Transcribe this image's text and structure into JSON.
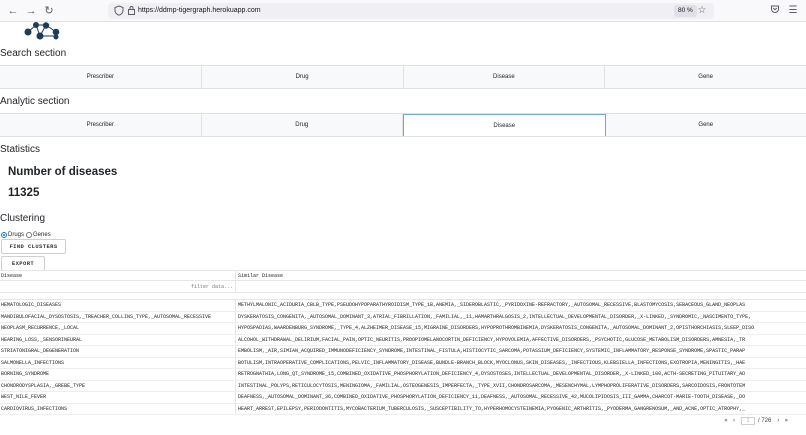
{
  "browser": {
    "url": "https://ddmp-tigergraph.herokuapp.com",
    "zoom": "80 %"
  },
  "search_section": {
    "title": "Search section",
    "tabs": [
      "Prescriber",
      "Drug",
      "Disease",
      "Gene"
    ]
  },
  "analytic_section": {
    "title": "Analytic section",
    "tabs": [
      "Prescriber",
      "Drug",
      "Disease",
      "Gene"
    ],
    "active_tab": "Disease"
  },
  "statistics": {
    "title": "Statistics",
    "metric_label": "Number of diseases",
    "metric_value": "11325"
  },
  "clustering": {
    "title": "Clustering",
    "options": [
      "Drugs",
      "Genes"
    ],
    "selected": "Drugs",
    "find_button": "FIND CLUSTERS",
    "export_button": "EXPORT"
  },
  "table": {
    "columns": [
      "Disease",
      "Similar Disease"
    ],
    "filter_placeholder": "filter data...",
    "rows": [
      [
        "HEMATOLOGIC_DISEASES",
        "METHYLMALONIC_ACIDURIA_CBLB_TYPE,PSEUDOHYPOPARATHYROIDISM_TYPE_1B,ANEMIA,_SIDEROBLASTIC,_PYRIDOXINE-REFRACTORY,_AUTOSOMAL_RECESSIVE,BLASTOMYCOSIS,SEBACEOUS_GLAND_NEOPLAS"
      ],
      [
        "MANDIBULOFACIAL_DYSOSTOSIS,_TREACHER_COLLINS_TYPE,_AUTOSOMAL_RECESSIVE",
        "DYSKERATOSIS_CONGENITA,_AUTOSOMAL_DOMINANT_3,ATRIAL_FIBRILLATION,_FAMILIAL,_11,HAMARTHRALGOSIS_2,INTELLECTUAL_DEVELOPMENTAL_DISORDER,_X-LINKED,_SYNDROMIC,_NASCIMENTO_TYPE,"
      ],
      [
        "NEOPLASM_RECURRENCE,_LOCAL",
        "HYPOSPADIAS,WAARDENBURG_SYNDROME,_TYPE_4,ALZHEIMER_DISEASE_15,MIGRAINE_DISORDERS,HYPOPROTHROMBINEMIA,DYSKERATOSIS_CONGENITA,_AUTOSOMAL_DOMINANT_2,OPISTHORCHIASIS,SLEEP_DISO"
      ],
      [
        "HEARING_LOSS,_SENSORINEURAL",
        "ALCOHOL_WITHDRAWAL_DELIRIUM,FACIAL_PAIN,OPTIC_NEURITIS,PROOPIOMELANOCORTIN_DEFICIENCY,HYPOVOLEMIA,AFFECTIVE_DISORDERS,_PSYCHOTIC,GLUCOSE_METABOLISM_DISORDERS,AMNESIA,_TR"
      ],
      [
        "STRIATONIGRAL_DEGENERATION",
        "EMBOLISM,_AIR,SIMIAN_ACQUIRED_IMMUNODEFICIENCY_SYNDROME,INTESTINAL_FISTULA,HISTIOCYTIC_SARCOMA,POTASSIUM_DEFICIENCY,SYSTEMIC_INFLAMMATORY_RESPONSE_SYNDROME,SPASTIC_PARAP"
      ],
      [
        "SALMONELLA_INFECTIONS",
        "BOTULISM,INTRAOPERATIVE_COMPLICATIONS,PELVIC_INFLAMMATORY_DISEASE,BUNDLE-BRANCH_BLOCK,MYOCLONUS,SKIN_DISEASES,_INFECTIOUS,KLEBSIELLA_INFECTIONS,EXOTROPIA,MENINGITIS,_HAE"
      ],
      [
        "BORNING_SYNDROME",
        "RETROGNATHIA,LONG_QT_SYNDROME_15,COMBINED_OXIDATIVE_PHOSPHORYLATION_DEFICIENCY_4,DYSOSTOSES,INTELLECTUAL_DEVELOPMENTAL_DISORDER,_X-LINKED_100,ACTH-SECRETING_PITUITARY_AD"
      ],
      [
        "CHONDRODYSPLASIA,_GREBE_TYPE",
        "INTESTINAL_POLYPS,RETICULOCYTOSIS,MENINGIOMA,_FAMILIAL,OSTEOGENESIS_IMPERFECTA,_TYPE_XVII,CHONDROSARCOMA,_MESENCHYMAL,LYMPHOPROLIFERATIVE_DISORDERS,SARCOIDOSIS,FRONTOTEM"
      ],
      [
        "WEST_NILE_FEVER",
        "DEAFNESS,_AUTOSOMAL_DOMINANT_36,COMBINED_OXIDATIVE_PHOSPHORYLATION_DEFICIENCY_11,DEAFNESS,_AUTOSOMAL_RECESSIVE_42,MUCOLIPIDOSIS_III_GAMMA,CHARCOT-MARIE-TOOTH_DISEASE,_DO"
      ],
      [
        "CARDIOVIRUS_INFECTIONS",
        "HEART_ARREST,EPILEPSY,PERIODONTITIS,MYCOBACTERIUM_TUBERCULOSIS,_SUSCEPTIBILITY_TO,HYPERHOMOCYSTEINEMIA,PYOGENIC_ARTHRITIS,_PYODERMA_GANGRENOSUM,_AND_ACNE,OPTIC_ATROPHY,_"
      ]
    ]
  },
  "pager": {
    "page": "1",
    "total": "/ 726"
  }
}
